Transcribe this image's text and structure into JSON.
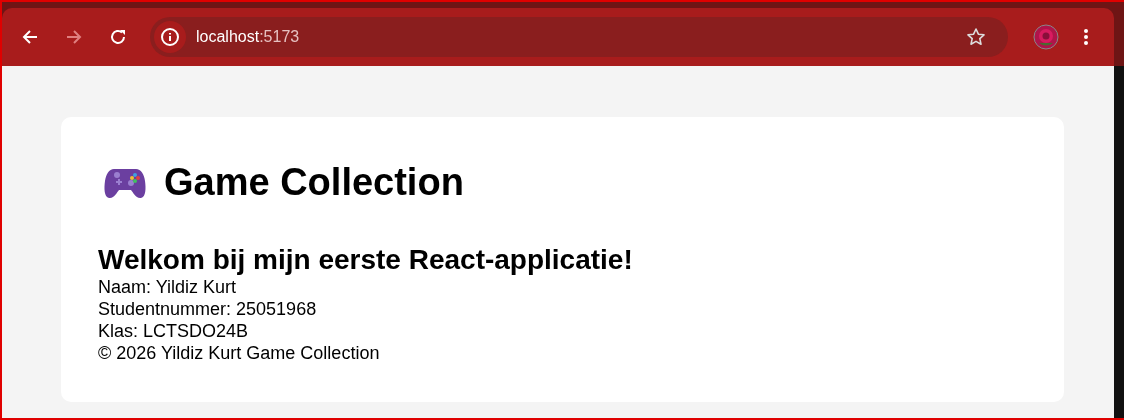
{
  "browser": {
    "nav": [
      {
        "kind": "back",
        "disabled": false
      },
      {
        "kind": "forward",
        "disabled": true
      },
      {
        "kind": "reload",
        "disabled": false
      }
    ],
    "url": {
      "host": "localhost",
      "port": ":5173"
    },
    "bookmarked": false
  },
  "page": {
    "title": "Game Collection",
    "subtitle": "Welkom bij mijn eerste React-applicatie!",
    "lines": [
      "Naam: Yildiz Kurt",
      "Studentnummer: 25051968",
      "Klas: LCTSDO24B",
      "© 2026 Yildiz Kurt Game Collection"
    ]
  }
}
